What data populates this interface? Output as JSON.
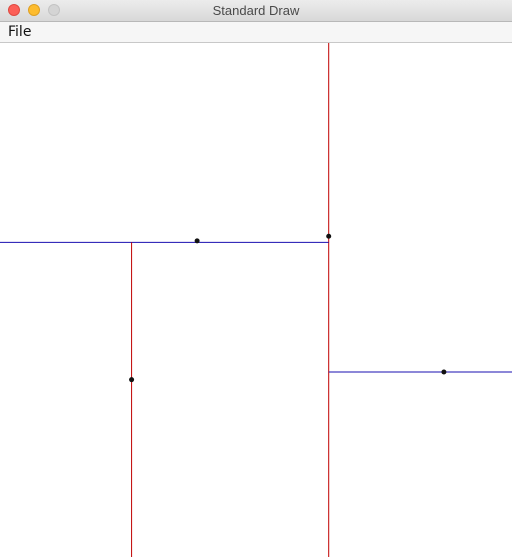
{
  "window": {
    "title": "Standard Draw"
  },
  "menubar": {
    "items": [
      {
        "label": "File"
      }
    ]
  },
  "colors": {
    "vertical_split": "#c00000",
    "horizontal_split": "#1a0fb0",
    "point": "#111111",
    "canvas_background": "#ffffff"
  },
  "drawing": {
    "description_type": "kd-tree",
    "points": [
      {
        "x": 0.385,
        "y": 0.615
      },
      {
        "x": 0.642,
        "y": 0.624
      },
      {
        "x": 0.257,
        "y": 0.345
      },
      {
        "x": 0.867,
        "y": 0.36
      }
    ],
    "splits": [
      {
        "orientation": "vertical",
        "value": 0.642,
        "from": 0.0,
        "to": 1.0
      },
      {
        "orientation": "horizontal",
        "value": 0.612,
        "from": 0.0,
        "to": 0.642
      },
      {
        "orientation": "vertical",
        "value": 0.257,
        "from": 0.0,
        "to": 0.612
      },
      {
        "orientation": "horizontal",
        "value": 0.36,
        "from": 0.642,
        "to": 1.0
      }
    ]
  }
}
